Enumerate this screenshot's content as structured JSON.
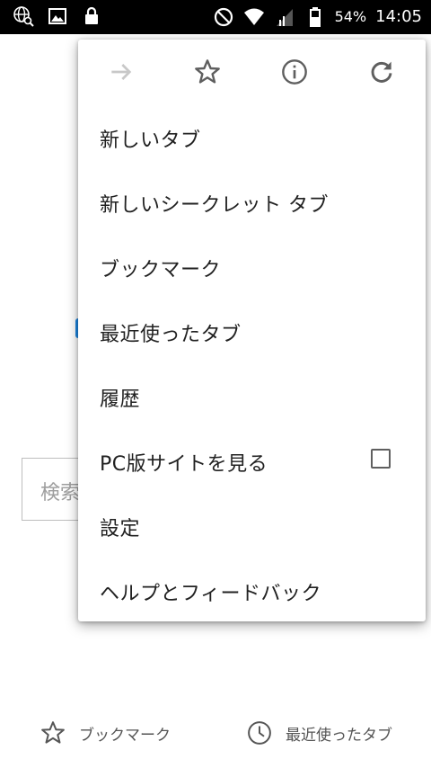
{
  "status_bar": {
    "battery": "54%",
    "time": "14:05"
  },
  "page": {
    "search_placeholder": "検索",
    "bottom_links": [
      {
        "label": "ブックマーク"
      },
      {
        "label": "最近使ったタブ"
      }
    ]
  },
  "menu": {
    "items": [
      {
        "label": "新しいタブ"
      },
      {
        "label": "新しいシークレット タブ"
      },
      {
        "label": "ブックマーク"
      },
      {
        "label": "最近使ったタブ"
      },
      {
        "label": "履歴"
      },
      {
        "label": "PC版サイトを見る",
        "checked": false
      },
      {
        "label": "設定"
      },
      {
        "label": "ヘルプとフィードバック"
      }
    ],
    "top_icons": [
      "forward-icon",
      "star-icon",
      "info-icon",
      "reload-icon"
    ]
  }
}
